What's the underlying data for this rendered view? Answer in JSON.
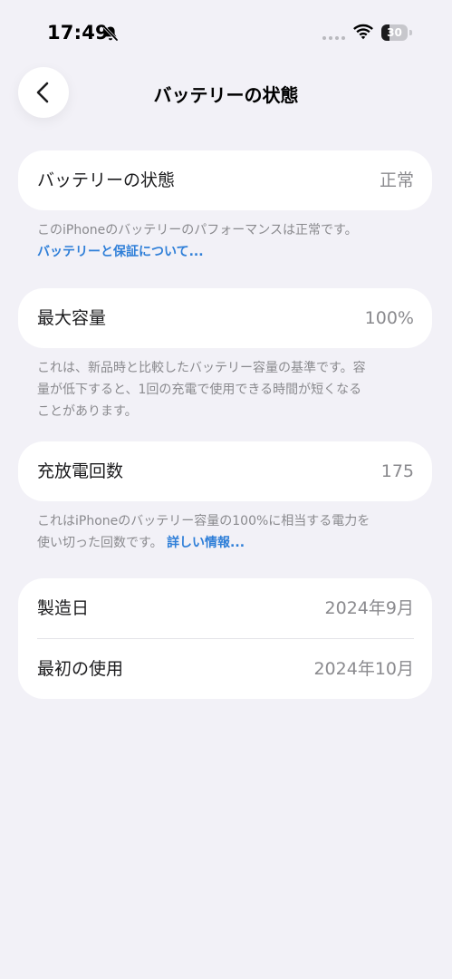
{
  "status_bar": {
    "time": "17:49",
    "battery_level": "30"
  },
  "header": {
    "title": "バッテリーの状態"
  },
  "battery_condition": {
    "label": "バッテリーの状態",
    "value": "正常",
    "note": "このiPhoneのバッテリーのパフォーマンスは正常です。",
    "link": "バッテリーと保証について..."
  },
  "max_capacity": {
    "label": "最大容量",
    "value": "100%",
    "note_line1": "これは、新品時と比較したバッテリー容量の基準です。容",
    "note_line2": "量が低下すると、1回の充電で使用できる時間が短くなる",
    "note_line3": "ことがあります。"
  },
  "cycle_count": {
    "label": "充放電回数",
    "value": "175",
    "note_line1": "これはiPhoneのバッテリー容量の100%に相当する電力を",
    "note_line2": "使い切った回数です。",
    "link": "詳しい情報..."
  },
  "dates": {
    "manufacture_label": "製造日",
    "manufacture_value": "2024年9月",
    "first_use_label": "最初の使用",
    "first_use_value": "2024年10月"
  },
  "colors": {
    "background": "#f2f1f7",
    "link": "#2f7fd8",
    "secondary_text": "#8a8a8e"
  },
  "icons": {
    "mute": "bell-slash-icon",
    "wifi": "wifi-icon",
    "back": "chevron-left-icon"
  }
}
